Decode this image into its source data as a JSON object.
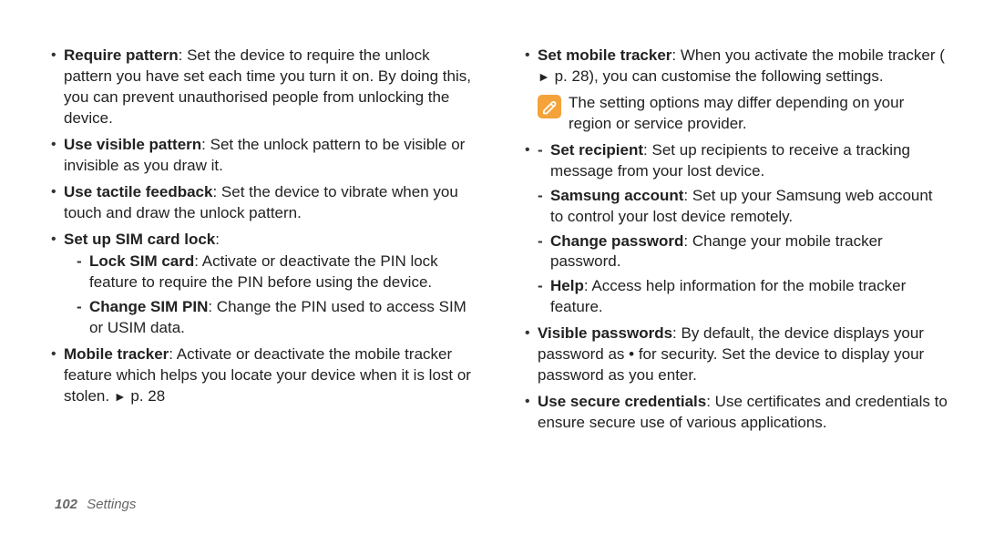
{
  "footer": {
    "page_number": "102",
    "section": "Settings"
  },
  "note_icon_name": "note-icon",
  "left": {
    "items": [
      {
        "bold": "Require pattern",
        "text": ": Set the device to require the unlock pattern you have set each time you turn it on. By doing this, you can prevent unauthorised people from unlocking the device."
      },
      {
        "bold": "Use visible pattern",
        "text": ": Set the unlock pattern to be visible or invisible as you draw it."
      },
      {
        "bold": "Use tactile feedback",
        "text": ": Set the device to vibrate when you touch and draw the unlock pattern."
      },
      {
        "bold": "Set up SIM card lock",
        "text": ":",
        "children": [
          {
            "bold": "Lock SIM card",
            "text": ": Activate or deactivate the PIN lock feature to require the PIN before using the device."
          },
          {
            "bold": "Change SIM PIN",
            "text": ": Change the PIN used to access SIM or USIM data."
          }
        ]
      },
      {
        "bold": "Mobile tracker",
        "text_pre": ": Activate or deactivate the mobile tracker feature which helps you locate your device when it is lost or stolen. ",
        "arrow": "►",
        "text_post": " p. 28"
      }
    ]
  },
  "right": {
    "first": {
      "bold": "Set mobile tracker",
      "text_pre": ": When you activate the mobile tracker ( ",
      "arrow": "►",
      "text_post": " p. 28), you can customise the following settings."
    },
    "note": "The setting options may differ depending on your region or service provider.",
    "sub": [
      {
        "bold": "Set recipient",
        "text": ": Set up recipients to receive a tracking message from your lost device."
      },
      {
        "bold": "Samsung account",
        "text": ": Set up your Samsung web account to control your lost device remotely."
      },
      {
        "bold": "Change password",
        "text": ": Change your mobile tracker password."
      },
      {
        "bold": "Help",
        "text": ": Access help information for the mobile tracker feature."
      }
    ],
    "items_after": [
      {
        "bold": "Visible passwords",
        "text": ": By default, the device displays your password as • for security. Set the device to display your password as you enter."
      },
      {
        "bold": "Use secure credentials",
        "text": ": Use certificates and credentials to ensure secure use of various applications."
      }
    ]
  }
}
